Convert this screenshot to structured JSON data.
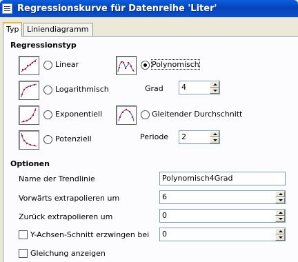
{
  "window": {
    "title": "Regressionskurve für Datenreihe 'Liter'"
  },
  "tabs": [
    {
      "label": "Typ",
      "active": true
    },
    {
      "label": "Liniendiagramm",
      "active": false
    }
  ],
  "regression": {
    "section_title": "Regressionstyp",
    "options": {
      "linear": {
        "label": "Linear",
        "selected": false
      },
      "log": {
        "label": "Logarithmisch",
        "selected": false
      },
      "exp": {
        "label": "Exponentiell",
        "selected": false
      },
      "pot": {
        "label": "Potenziell",
        "selected": false
      },
      "poly": {
        "label": "Polynomisch",
        "selected": true
      },
      "moving": {
        "label": "Gleitender Durchschnitt",
        "selected": false
      }
    },
    "grad_label": "Grad",
    "grad_value": "4",
    "periode_label": "Periode",
    "periode_value": "2"
  },
  "options": {
    "section_title": "Optionen",
    "trendline_name_label": "Name der Trendlinie",
    "trendline_name_value": "Polynomisch4Grad",
    "forward_label": "Vorwärts extrapolieren um",
    "forward_value": "6",
    "backward_label": "Zurück extrapolieren um",
    "backward_value": "0",
    "force_intercept_label": "Y-Achsen-Schnitt erzwingen bei",
    "force_intercept_checked": false,
    "force_intercept_value": "0",
    "show_equation_label": "Gleichung anzeigen",
    "show_equation_checked": false
  }
}
